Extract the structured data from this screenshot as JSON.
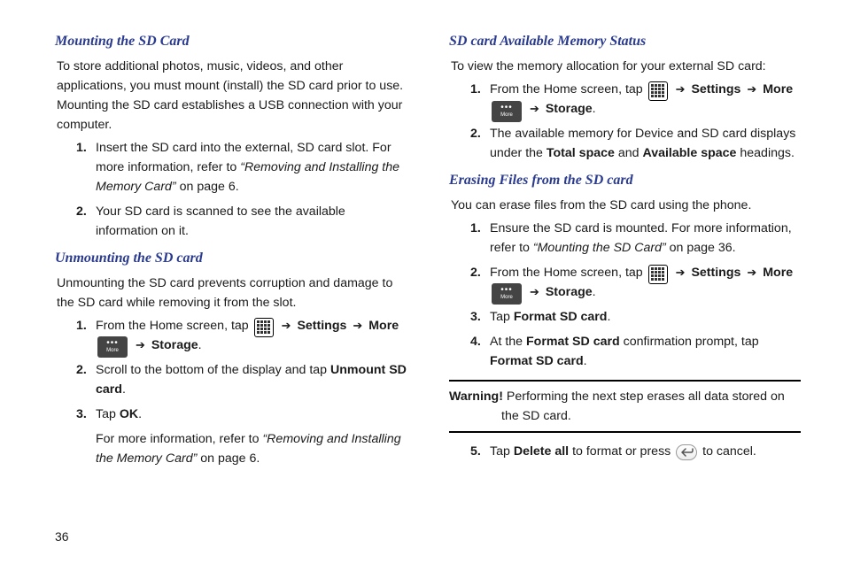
{
  "page_number": "36",
  "arrow": "➔",
  "left": {
    "h1": "Mounting the SD Card",
    "p1": "To store additional photos, music, videos, and other applications, you must mount (install) the SD card prior to use. Mounting the SD card establishes a USB connection with your computer.",
    "s1a": "Insert the SD card into the external, SD card slot. For more information, refer to ",
    "s1ref": "“Removing and Installing the Memory Card”",
    "s1b": "  on page 6.",
    "s2": "Your SD card is scanned to see the available information on it.",
    "h2": "Unmounting the SD card",
    "p2": "Unmounting the SD card prevents corruption and damage to the SD card while removing it from the slot.",
    "u1a": "From the Home screen, tap ",
    "u1_settings": "Settings",
    "u1_more": "More",
    "u1_storage": "Storage",
    "u2a": "Scroll to the bottom of the display and tap ",
    "u2b": "Unmount SD card",
    "u3a": "Tap ",
    "u3b": "OK",
    "u3sub_a": "For more information, refer to ",
    "u3sub_ref": "“Removing and Installing the Memory Card”",
    "u3sub_b": "  on page 6."
  },
  "right": {
    "h1": "SD card Available Memory Status",
    "p1": "To view the memory allocation for your external SD card:",
    "a1a": "From the Home screen, tap ",
    "a1_settings": "Settings",
    "a1_more": "More",
    "a1_storage": "Storage",
    "a2a": "The available memory for Device and SD card displays under the ",
    "a2_total": "Total space",
    "a2_and": " and ",
    "a2_avail": "Available space",
    "a2b": " headings.",
    "h2": "Erasing Files from the SD card",
    "p2": "You can erase files from the SD card using the phone.",
    "e1a": "Ensure the SD card is mounted. For more information, refer to ",
    "e1ref": "“Mounting the SD Card”",
    "e1b": "  on page 36.",
    "e2a": "From the Home screen, tap ",
    "e2_settings": "Settings",
    "e2_more": "More",
    "e2_storage": "Storage",
    "e3a": "Tap ",
    "e3b": "Format SD card",
    "e4a": "At the ",
    "e4b": "Format SD card",
    "e4c": " confirmation prompt, tap ",
    "e4d": "Format SD card",
    "warn_label": "Warning!",
    "warn_text": " Performing the next step erases all data stored on the SD card.",
    "e5a": "Tap ",
    "e5b": "Delete all",
    "e5c": " to format or press ",
    "e5d": " to cancel."
  }
}
